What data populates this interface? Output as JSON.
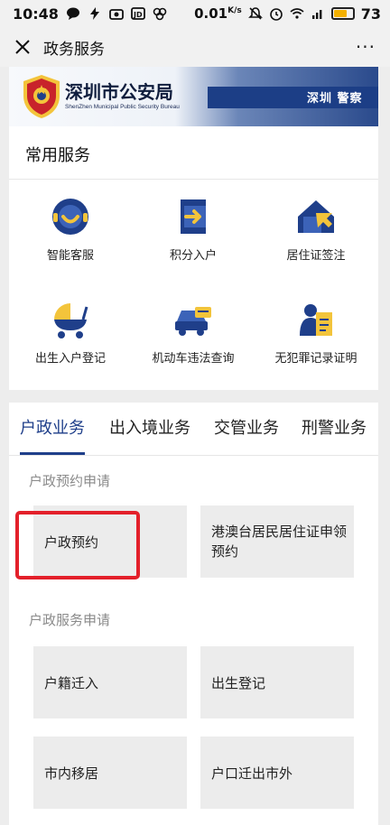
{
  "status_bar": {
    "time": "10:48",
    "net_speed": "0.01",
    "net_unit": "K/s",
    "battery": "73",
    "icons": [
      "chat-bubble-icon",
      "bolt-icon",
      "camera-icon",
      "jd-icon",
      "pinwheel-icon",
      "mute-icon",
      "alarm-icon",
      "wifi-icon",
      "signal-icon"
    ]
  },
  "titlebar": {
    "title": "政务服务",
    "more": "···"
  },
  "banner": {
    "title": "深圳市公安局",
    "subtitle": "ShenZhen Municipal Public Security Bureau",
    "right_text": "深圳 警察"
  },
  "common_services": {
    "heading": "常用服务",
    "items": [
      {
        "label": "智能客服",
        "icon": "smiley-service-icon"
      },
      {
        "label": "积分入户",
        "icon": "door-arrow-icon"
      },
      {
        "label": "居住证签注",
        "icon": "house-cursor-icon"
      },
      {
        "label": "出生入户登记",
        "icon": "baby-stroller-icon"
      },
      {
        "label": "机动车违法查询",
        "icon": "car-ticket-icon"
      },
      {
        "label": "无犯罪记录证明",
        "icon": "shield-document-icon"
      }
    ]
  },
  "tabs": [
    {
      "label": "户政业务",
      "active": true
    },
    {
      "label": "出入境业务",
      "active": false
    },
    {
      "label": "交管业务",
      "active": false
    },
    {
      "label": "刑警业务",
      "active": false
    }
  ],
  "huzheng": {
    "appointment_heading": "户政预约申请",
    "appointment_items": [
      "户政预约",
      "港澳台居民居住证申领预约"
    ],
    "service_heading": "户政服务申请",
    "service_items": [
      "户籍迁入",
      "出生登记",
      "市内移居",
      "户口迁出市外"
    ]
  },
  "colors": {
    "primary": "#1f3f8a",
    "accent_yellow": "#f3c43b",
    "highlight_red": "#e3202a"
  }
}
